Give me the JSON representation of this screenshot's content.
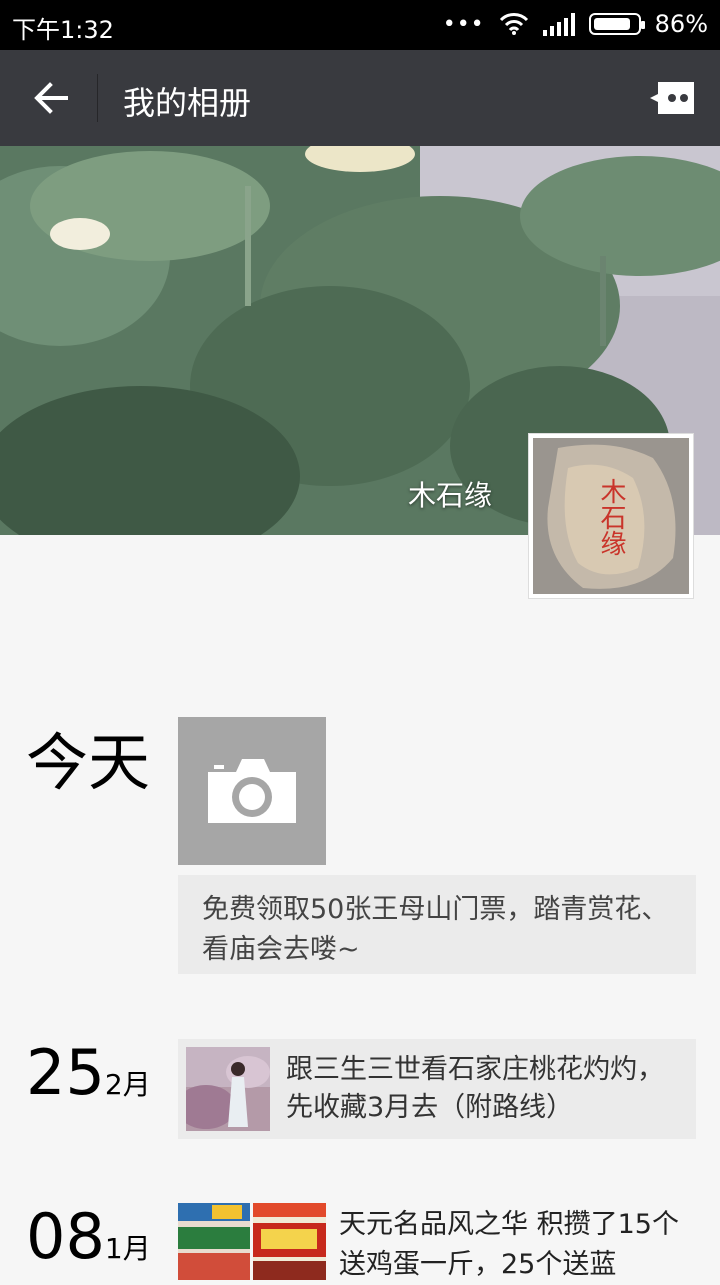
{
  "status_bar": {
    "time": "下午1:32",
    "dots": "•••",
    "battery": "86%",
    "battery_level": 0.86
  },
  "header": {
    "title": "我的相册",
    "back_icon": "arrow-left-icon",
    "message_icon": "message-icon"
  },
  "profile": {
    "nickname": "木石缘",
    "avatar_text": "木石缘"
  },
  "timeline": [
    {
      "day": "今天",
      "post_text": "免费领取50张王母山门票，踏青赏花、看庙会去喽~"
    },
    {
      "day": "25",
      "month": "2月",
      "post_text": "跟三生三世看石家庄桃花灼灼，先收藏3月去（附路线）"
    },
    {
      "day": "08",
      "month": "1月",
      "post_text": "天元名品风之华  积攒了15个送鸡蛋一斤，25个送蓝"
    }
  ]
}
